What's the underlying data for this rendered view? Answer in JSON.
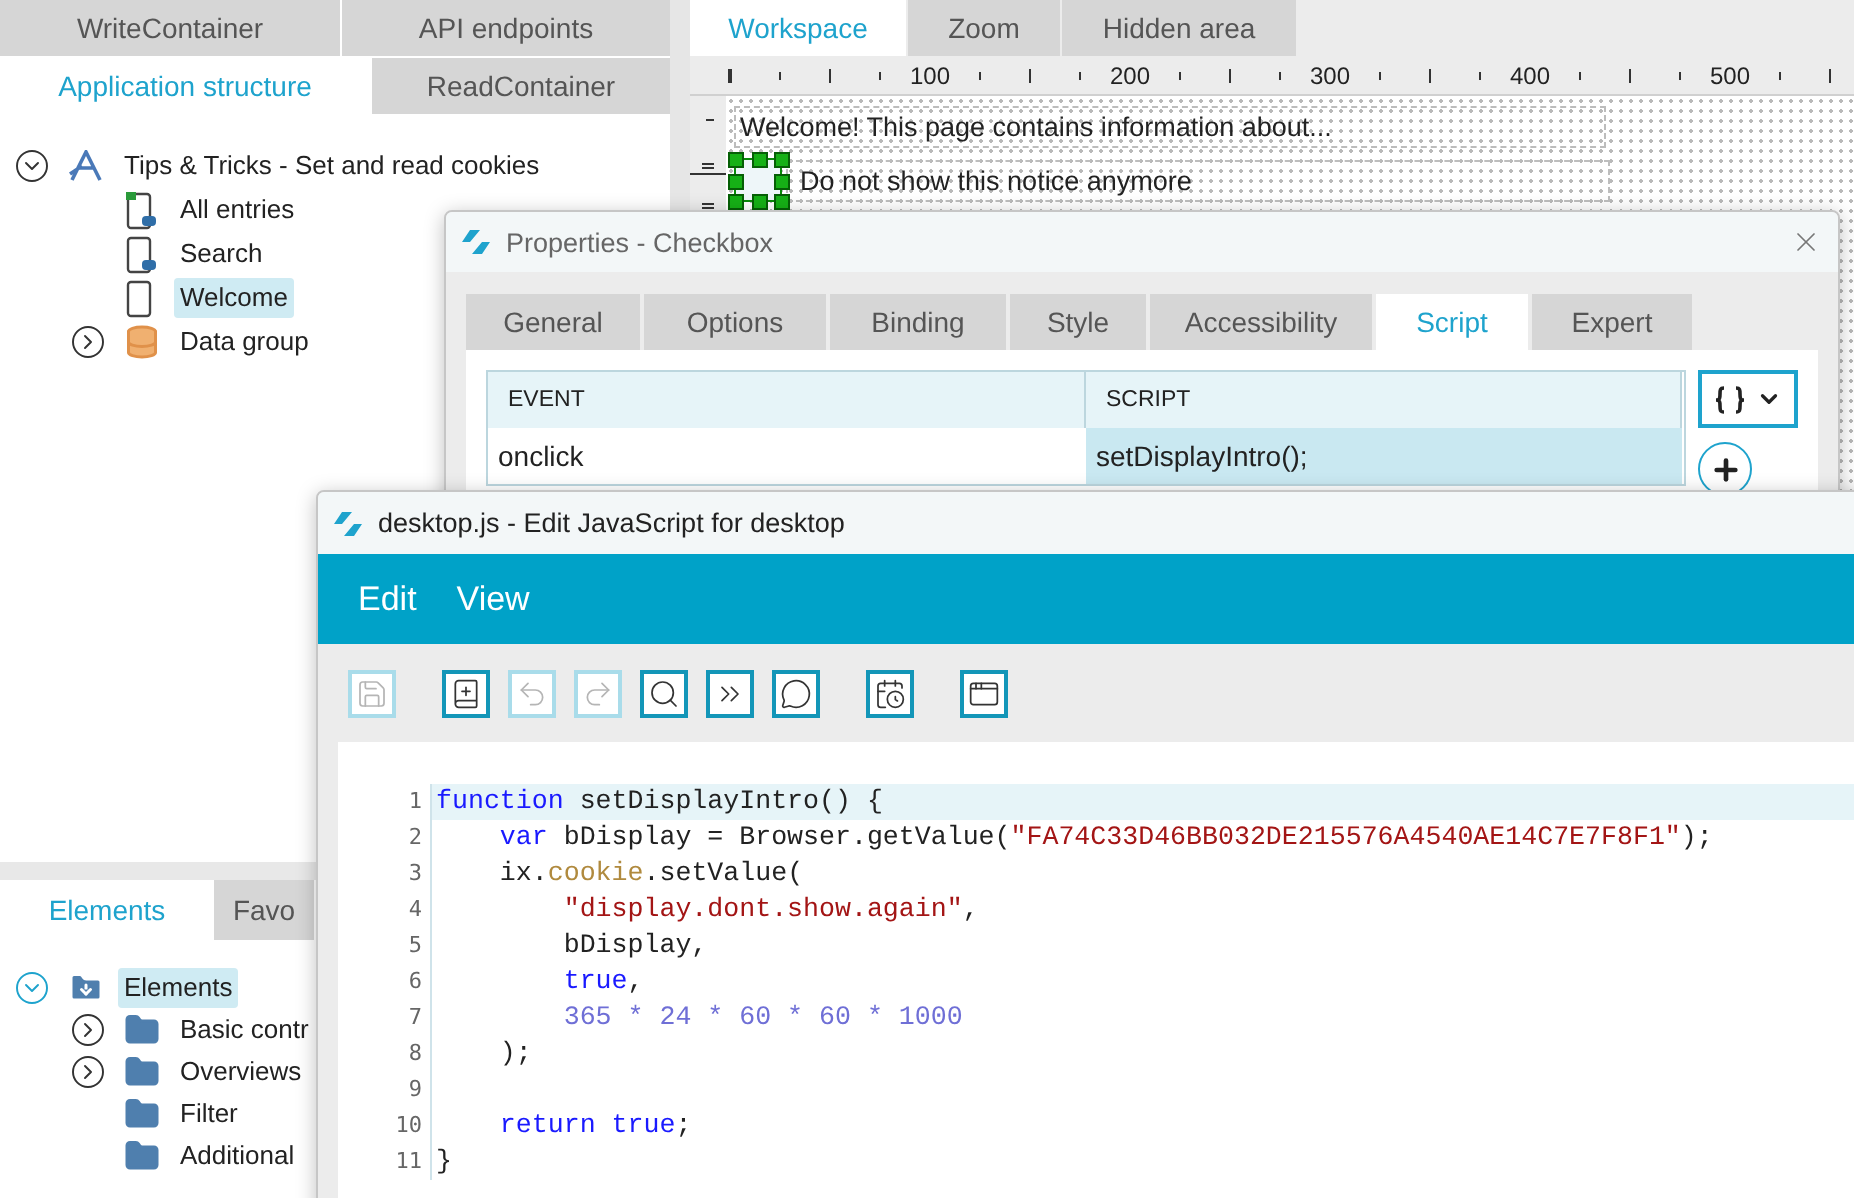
{
  "left_panel": {
    "tab_rows": [
      [
        {
          "label": "WriteContainer",
          "selected": false
        },
        {
          "label": "API endpoints",
          "selected": false
        }
      ],
      [
        {
          "label": "Application structure",
          "selected": true
        },
        {
          "label": "ReadContainer",
          "selected": false
        }
      ]
    ],
    "structure_tree": [
      {
        "label": "Tips & Tricks - Set and read cookies",
        "kind": "app",
        "expanded": true,
        "selected": false,
        "children": [
          {
            "label": "All entries",
            "kind": "start-page",
            "selected": false
          },
          {
            "label": "Search",
            "kind": "linked-page",
            "selected": false
          },
          {
            "label": "Welcome",
            "kind": "page",
            "selected": true
          },
          {
            "label": "Data group",
            "kind": "data",
            "expanded": false,
            "selected": false
          }
        ]
      }
    ],
    "lower_tabs": [
      {
        "label": "Elements",
        "selected": true
      },
      {
        "label": "Favo",
        "selected": false
      }
    ],
    "elements_tree": [
      {
        "label": "Elements",
        "kind": "root-folder",
        "expanded": true,
        "selected": true,
        "children": [
          {
            "label": "Basic contr",
            "kind": "folder",
            "expanded": false,
            "selected": false
          },
          {
            "label": "Overviews",
            "kind": "folder",
            "expanded": false,
            "selected": false
          },
          {
            "label": "Filter",
            "kind": "folder",
            "selected": false
          },
          {
            "label": "Additional",
            "kind": "folder",
            "selected": false
          }
        ]
      }
    ]
  },
  "workspace": {
    "tabs": [
      {
        "label": "Workspace",
        "selected": true
      },
      {
        "label": "Zoom",
        "selected": false
      },
      {
        "label": "Hidden area",
        "selected": false
      }
    ],
    "ruler_labels": [
      "100",
      "200",
      "300",
      "400",
      "500"
    ],
    "text_element": "Welcome! This page contains information about...",
    "checkbox": {
      "label": "Do not show this notice anymore",
      "checked": false,
      "selected": true
    }
  },
  "properties_dialog": {
    "title": "Properties - Checkbox",
    "tabs": [
      {
        "label": "General",
        "selected": false
      },
      {
        "label": "Options",
        "selected": false
      },
      {
        "label": "Binding",
        "selected": false
      },
      {
        "label": "Style",
        "selected": false
      },
      {
        "label": "Accessibility",
        "selected": false
      },
      {
        "label": "Script",
        "selected": true
      },
      {
        "label": "Expert",
        "selected": false
      }
    ],
    "columns": [
      "EVENT",
      "SCRIPT"
    ],
    "rows": [
      {
        "event": "onclick",
        "script": "setDisplayIntro();",
        "selected": true
      }
    ]
  },
  "editor": {
    "title": "desktop.js - Edit JavaScript for desktop",
    "menu": [
      "Edit",
      "View"
    ],
    "toolbar": [
      [
        {
          "kind": "save",
          "disabled": true
        }
      ],
      [
        {
          "kind": "book",
          "disabled": false
        },
        {
          "kind": "undo",
          "disabled": true
        },
        {
          "kind": "redo",
          "disabled": true
        },
        {
          "kind": "search",
          "disabled": false
        },
        {
          "kind": "chevrons",
          "disabled": false
        },
        {
          "kind": "comment",
          "disabled": false
        }
      ],
      [
        {
          "kind": "calendar",
          "disabled": false
        }
      ],
      [
        {
          "kind": "window",
          "disabled": false
        }
      ]
    ],
    "code": [
      {
        "number": "1",
        "current": true,
        "tokens": [
          {
            "text": "function",
            "kind": "keyword"
          },
          {
            "text": " setDisplayIntro() {",
            "kind": "plain"
          }
        ]
      },
      {
        "number": "2",
        "current": false,
        "tokens": [
          {
            "text": "    var",
            "kind": "keyword"
          },
          {
            "text": " bDisplay = Browser.getValue(",
            "kind": "plain"
          },
          {
            "text": "\"FA74C33D46BB032DE215576A4540AE14C7E7F8F1\"",
            "kind": "string"
          },
          {
            "text": ");",
            "kind": "plain"
          }
        ]
      },
      {
        "number": "3",
        "current": false,
        "tokens": [
          {
            "text": "    ix.",
            "kind": "plain"
          },
          {
            "text": "cookie",
            "kind": "property"
          },
          {
            "text": ".setValue(",
            "kind": "plain"
          }
        ]
      },
      {
        "number": "4",
        "current": false,
        "tokens": [
          {
            "text": "        \"display.dont.show.again\"",
            "kind": "string"
          },
          {
            "text": ",",
            "kind": "plain"
          }
        ]
      },
      {
        "number": "5",
        "current": false,
        "tokens": [
          {
            "text": "        bDisplay,",
            "kind": "plain"
          }
        ]
      },
      {
        "number": "6",
        "current": false,
        "tokens": [
          {
            "text": "        true",
            "kind": "keyword"
          },
          {
            "text": ",",
            "kind": "plain"
          }
        ]
      },
      {
        "number": "7",
        "current": false,
        "tokens": [
          {
            "text": "        365 * 24 * 60 * 60 * 1000",
            "kind": "number"
          }
        ]
      },
      {
        "number": "8",
        "current": false,
        "tokens": [
          {
            "text": "    );",
            "kind": "plain"
          }
        ]
      },
      {
        "number": "9",
        "current": false
      },
      {
        "number": "10",
        "current": false,
        "tokens": [
          {
            "text": "    return true",
            "kind": "keyword"
          },
          {
            "text": ";",
            "kind": "plain"
          }
        ]
      },
      {
        "number": "11",
        "current": false,
        "tokens": [
          {
            "text": "}",
            "kind": "plain"
          }
        ]
      }
    ]
  }
}
